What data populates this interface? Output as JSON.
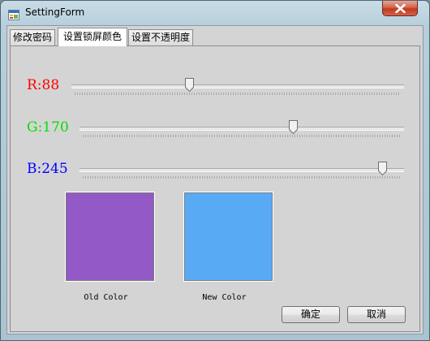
{
  "window": {
    "title": "SettingForm",
    "icon": "windows-form-icon",
    "close_icon": "close-x-icon",
    "close_color": "#c7432b"
  },
  "tabs": [
    {
      "label": "修改密码",
      "active": false
    },
    {
      "label": "设置锁屏颜色",
      "active": true
    },
    {
      "label": "设置不透明度",
      "active": false
    }
  ],
  "sliders": {
    "r": {
      "label": "R:88",
      "value": 88,
      "min": 0,
      "max": 255,
      "color": "#ff0000"
    },
    "g": {
      "label": "G:170",
      "value": 170,
      "min": 0,
      "max": 255,
      "color": "#00e000"
    },
    "b": {
      "label": "B:245",
      "value": 245,
      "min": 0,
      "max": 255,
      "color": "#0000ff"
    }
  },
  "swatches": {
    "old": {
      "caption": "Old Color",
      "color": "#9359c6"
    },
    "new": {
      "caption": "New Color",
      "color": "#58aaf5"
    }
  },
  "buttons": {
    "ok_label": "确定",
    "cancel_label": "取消"
  }
}
